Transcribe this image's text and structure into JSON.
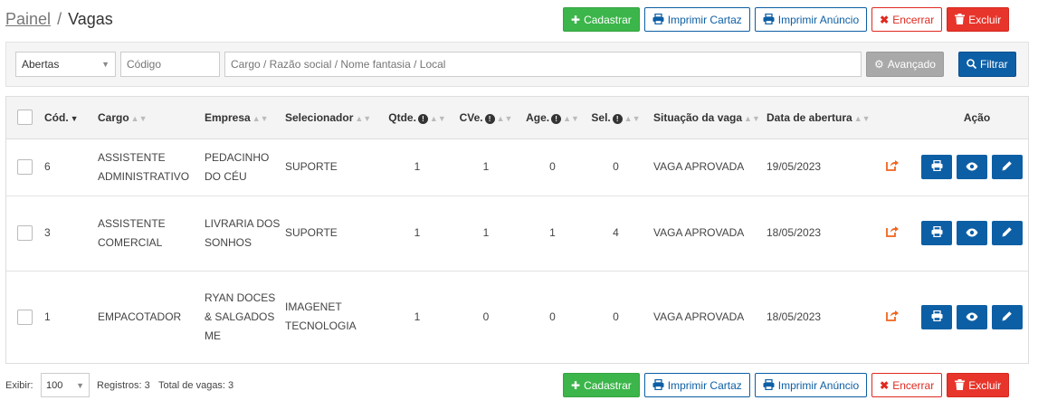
{
  "breadcrumb": {
    "parent": "Painel",
    "separator": "/",
    "current": "Vagas"
  },
  "toolbar": {
    "cadastrar": "Cadastrar",
    "imprimir_cartaz": "Imprimir Cartaz",
    "imprimir_anuncio": "Imprimir Anúncio",
    "encerrar": "Encerrar",
    "excluir": "Excluir"
  },
  "filters": {
    "status_value": "Abertas",
    "codigo_placeholder": "Código",
    "search_placeholder": "Cargo / Razão social / Nome fantasia / Local",
    "avancado": "Avançado",
    "filtrar": "Filtrar"
  },
  "table": {
    "headers": {
      "cod": "Cód.",
      "cargo": "Cargo",
      "empresa": "Empresa",
      "selecionador": "Selecionador",
      "qtde": "Qtde.",
      "cve": "CVe.",
      "age": "Age.",
      "sel": "Sel.",
      "situacao": "Situação da vaga",
      "data": "Data de abertura",
      "acao": "Ação"
    },
    "rows": [
      {
        "cod": "6",
        "cargo": "ASSISTENTE ADMINISTRATIVO",
        "empresa": "PEDACINHO DO CÉU",
        "selecionador": "SUPORTE",
        "qtde": "1",
        "cve": "1",
        "age": "0",
        "sel": "0",
        "situacao": "VAGA APROVADA",
        "data": "19/05/2023"
      },
      {
        "cod": "3",
        "cargo": "ASSISTENTE COMERCIAL",
        "empresa": "LIVRARIA DOS SONHOS",
        "selecionador": "SUPORTE",
        "qtde": "1",
        "cve": "1",
        "age": "1",
        "sel": "4",
        "situacao": "VAGA APROVADA",
        "data": "18/05/2023"
      },
      {
        "cod": "1",
        "cargo": "EMPACOTADOR",
        "empresa": "RYAN DOCES & SALGADOS ME",
        "selecionador": "IMAGENET TECNOLOGIA",
        "qtde": "1",
        "cve": "0",
        "age": "0",
        "sel": "0",
        "situacao": "VAGA APROVADA",
        "data": "18/05/2023"
      }
    ]
  },
  "footer": {
    "exibir_label": "Exibir:",
    "page_size": "100",
    "registros": "Registros: 3",
    "total_vagas": "Total de vagas: 3"
  },
  "icons": {
    "cadastrar": "plus-icon",
    "imprimir": "printer-icon",
    "encerrar": "x-icon",
    "excluir": "trash-icon",
    "avancado": "gears-icon",
    "filtrar": "search-icon",
    "share": "share-icon",
    "view": "eye-icon",
    "edit": "pencil-icon"
  },
  "colors": {
    "success": "#3cb54a",
    "primary": "#0d5fa5",
    "danger": "#e8352b",
    "share": "#f0641e"
  }
}
